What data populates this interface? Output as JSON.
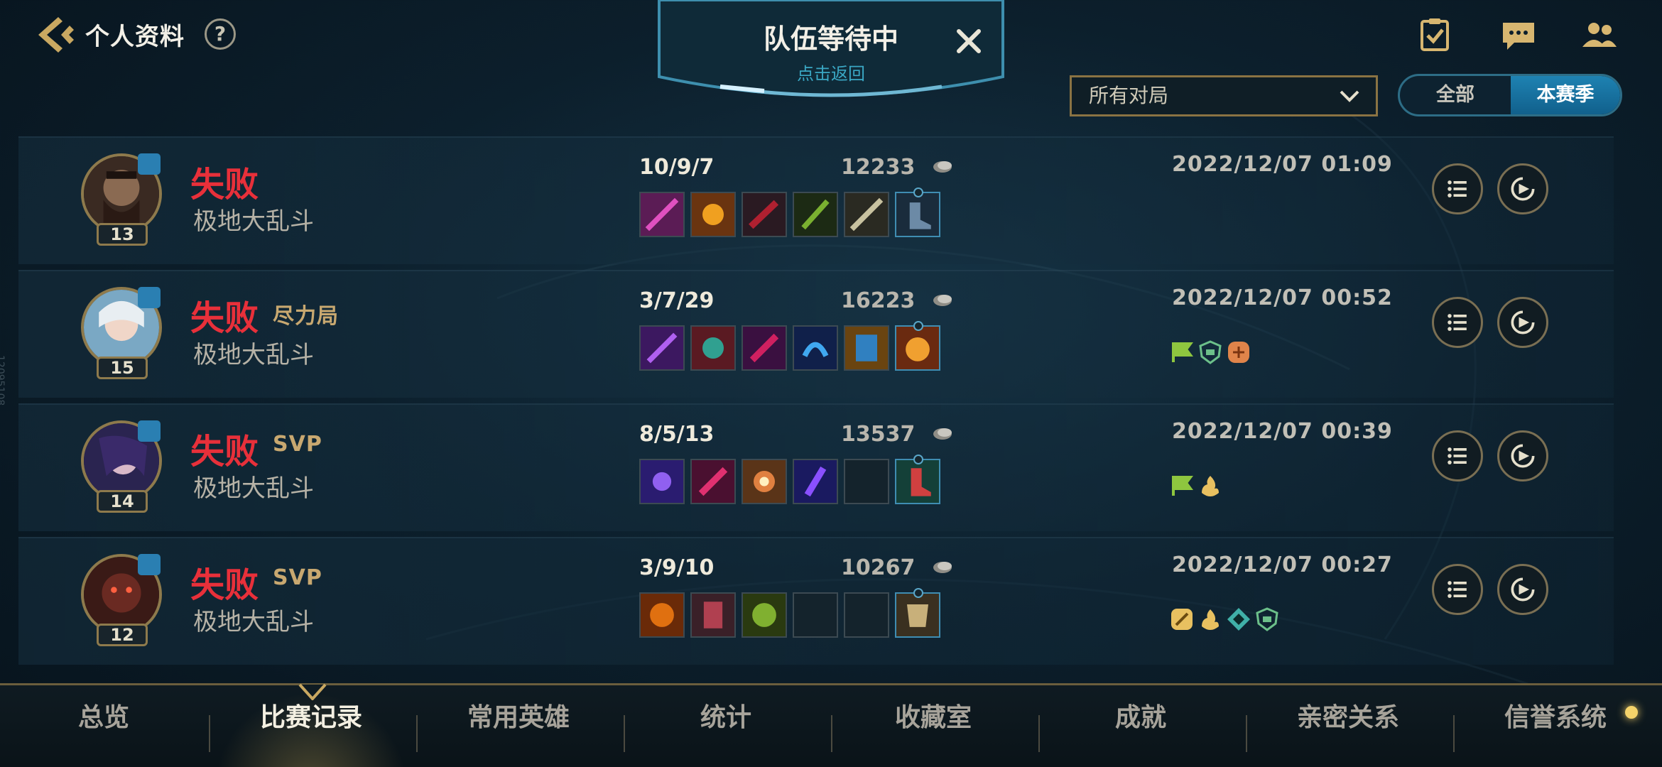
{
  "header": {
    "title": "个人资料",
    "help_icon": "?",
    "queue_title": "队伍等待中",
    "queue_subtitle": "点击返回"
  },
  "filters": {
    "match_filter": "所有对局",
    "season_options": [
      "全部",
      "本赛季"
    ],
    "season_selected": "本赛季"
  },
  "matches": [
    {
      "result": "失败",
      "tag": "",
      "mode": "极地大乱斗",
      "level": "13",
      "kda": "10/9/7",
      "gold": "12233",
      "date": "2022/12/07 01:09",
      "honors": []
    },
    {
      "result": "失败",
      "tag": "尽力局",
      "mode": "极地大乱斗",
      "level": "15",
      "kda": "3/7/29",
      "gold": "16223",
      "date": "2022/12/07 00:52",
      "honors": [
        "flag-icon",
        "shield-icon",
        "orange-badge-icon"
      ]
    },
    {
      "result": "失败",
      "tag": "SVP",
      "mode": "极地大乱斗",
      "level": "14",
      "kda": "8/5/13",
      "gold": "13537",
      "date": "2022/12/07 00:39",
      "honors": [
        "flag-icon",
        "flame-icon"
      ]
    },
    {
      "result": "失败",
      "tag": "SVP",
      "mode": "极地大乱斗",
      "level": "12",
      "kda": "3/9/10",
      "gold": "10267",
      "date": "2022/12/07 00:27",
      "honors": [
        "sword-badge-icon",
        "flame-icon",
        "diamond-shield-icon",
        "shield-icon"
      ]
    }
  ],
  "nav": {
    "items": [
      "总览",
      "比赛记录",
      "常用英雄",
      "统计",
      "收藏室",
      "成就",
      "亲密关系",
      "信誉系统"
    ],
    "active": "比赛记录"
  },
  "side_code": "12095108",
  "colors": {
    "defeat": "#e8303a",
    "gold_border": "#8e7a4c",
    "accent_blue": "#1e82b2"
  }
}
